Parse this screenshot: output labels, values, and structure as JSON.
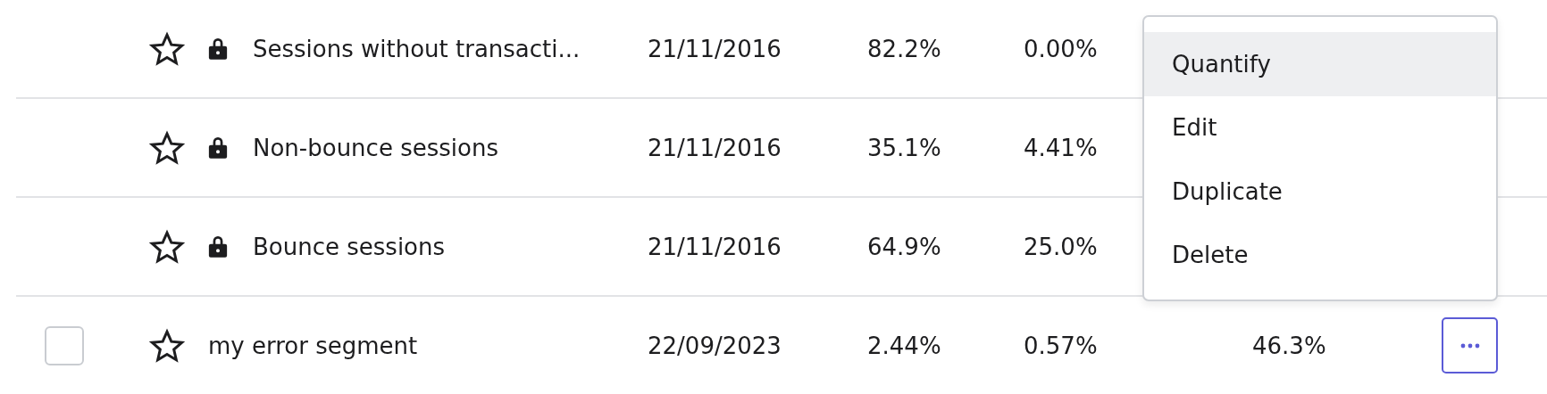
{
  "rows": [
    {
      "locked": true,
      "starred": false,
      "name": "Sessions without transacti...",
      "date": "21/11/2016",
      "column_5": "82.2%",
      "column_6": "0.00%"
    },
    {
      "locked": true,
      "starred": false,
      "name": "Non-bounce sessions",
      "date": "21/11/2016",
      "column_5": "35.1%",
      "column_6": "4.41%"
    },
    {
      "locked": true,
      "starred": false,
      "name": "Bounce sessions",
      "date": "21/11/2016",
      "column_5": "64.9%",
      "column_6": "25.0%"
    },
    {
      "locked": false,
      "checked": false,
      "starred": false,
      "name": "my error segment",
      "date": "22/09/2023",
      "column_5": "2.44%",
      "column_6": "0.57%",
      "column_7": "46.3%",
      "has_actions": true
    }
  ],
  "menu": {
    "items": [
      {
        "label": "Quantify",
        "selected": true
      },
      {
        "label": "Edit",
        "selected": false
      },
      {
        "label": "Duplicate",
        "selected": false
      },
      {
        "label": "Delete",
        "selected": false
      }
    ]
  }
}
